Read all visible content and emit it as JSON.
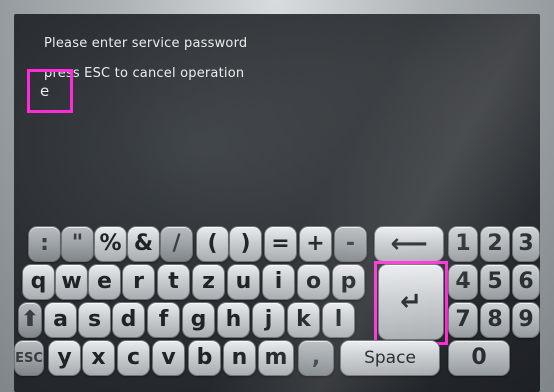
{
  "dialog": {
    "line1": "Please enter service password",
    "line2": "press ESC to cancel operation",
    "entered_text": "e"
  },
  "keyboard": {
    "row1": [
      ":",
      "\"",
      "%",
      "&",
      "/",
      "(",
      ")",
      "=",
      "+",
      "-"
    ],
    "backspace_glyph": "⟵",
    "row2": [
      "q",
      "w",
      "e",
      "r",
      "t",
      "z",
      "u",
      "i",
      "o",
      "p"
    ],
    "row3_shift_glyph": "⬆",
    "row3": [
      "a",
      "s",
      "d",
      "f",
      "g",
      "h",
      "j",
      "k",
      "l"
    ],
    "enter_glyph": "↵",
    "row4_esc": "ESC",
    "row4": [
      "y",
      "x",
      "c",
      "v",
      "b",
      "n",
      "m",
      ","
    ],
    "space_label": "Space",
    "numpad": [
      [
        "1",
        "2",
        "3"
      ],
      [
        "4",
        "5",
        "6"
      ],
      [
        "7",
        "8",
        "9"
      ],
      [
        "0"
      ]
    ]
  },
  "colors": {
    "highlight": "#ff2bd6",
    "screen": "#2c3034",
    "text": "#e9ecef"
  }
}
